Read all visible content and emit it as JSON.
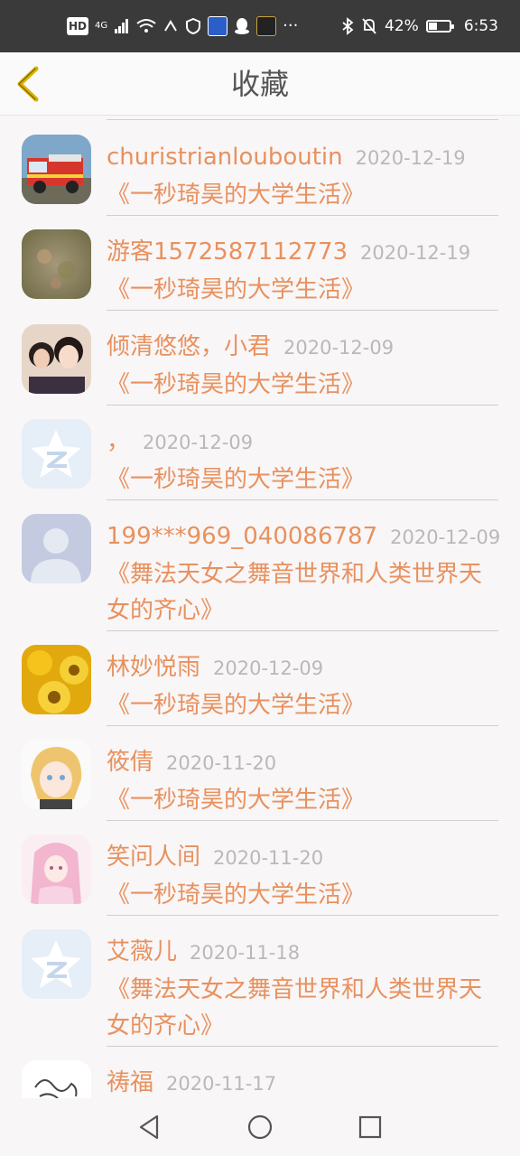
{
  "status_bar": {
    "left_icons": [
      "HD",
      "4G",
      "signal-icon",
      "wifi-icon",
      "nfc-icon",
      "shield-icon",
      "app-badge-icon",
      "qq-icon",
      "app-badge-icon",
      "more-icon"
    ],
    "hd_label": "HD",
    "network_label": "4G",
    "more_label": "···",
    "battery_percent": "42%",
    "battery_level": 0.42,
    "time": "6:53"
  },
  "header": {
    "title": "收藏",
    "back_icon": "chevron-left-icon",
    "accent_color": "#d8b100"
  },
  "items": [
    {
      "name": "churistrianlouboutin",
      "date": "2020-12-19",
      "book": "《一秒琦昊的大学生活》",
      "avatar": "fire-truck-photo"
    },
    {
      "name": "游客1572587112773",
      "date": "2020-12-19",
      "book": "《一秒琦昊的大学生活》",
      "avatar": "blurred-photo"
    },
    {
      "name": "倾清悠悠，小君",
      "date": "2020-12-09",
      "book": "《一秒琦昊的大学生活》",
      "avatar": "selfie-photo"
    },
    {
      "name": "，",
      "date": "2020-12-09",
      "book": "《一秒琦昊的大学生活》",
      "avatar": "qzone-default-icon"
    },
    {
      "name": "199***969_040086787",
      "date": "2020-12-09",
      "book": "《舞法天女之舞音世界和人类世界天女的齐心》",
      "avatar": "default-person-icon"
    },
    {
      "name": "林妙悦雨",
      "date": "2020-12-09",
      "book": "《一秒琦昊的大学生活》",
      "avatar": "sunflower-photo"
    },
    {
      "name": "筱倩",
      "date": "2020-11-20",
      "book": "《一秒琦昊的大学生活》",
      "avatar": "anime-girl-photo"
    },
    {
      "name": "笑问人间",
      "date": "2020-11-20",
      "book": "《一秒琦昊的大学生活》",
      "avatar": "anime-pink-photo"
    },
    {
      "name": "艾薇儿",
      "date": "2020-11-18",
      "book": "《舞法天女之舞音世界和人类世界天女的齐心》",
      "avatar": "qzone-default-icon"
    },
    {
      "name": "祷福",
      "date": "2020-11-17",
      "book": "",
      "avatar": "sketch-photo"
    }
  ],
  "colors": {
    "name": "#e8915e",
    "date": "#b9b9b9",
    "divider": "#cfcfcf",
    "status_bar_bg": "#3a3a3a"
  },
  "nav_bar": {
    "buttons": [
      "back-triangle-icon",
      "home-circle-icon",
      "recents-square-icon"
    ]
  }
}
